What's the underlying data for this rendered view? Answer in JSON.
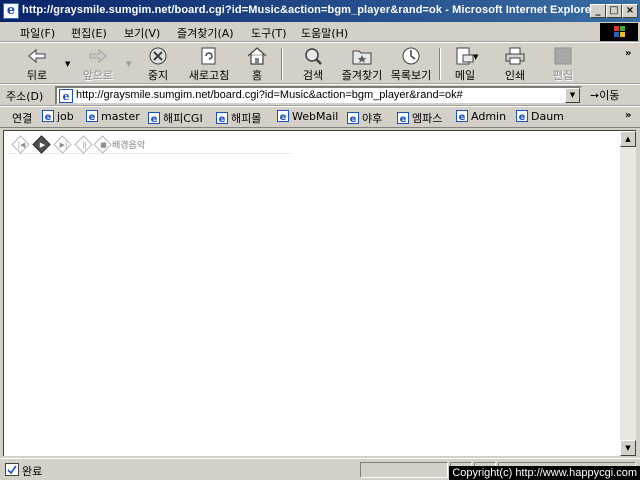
{
  "window": {
    "title": "http://graysmile.sumgim.net/board.cgi?id=Music&action=bgm_player&rand=ok - Microsoft Internet Explorer",
    "icon": "ie-icon",
    "minimize": "_",
    "maximize": "□",
    "close": "×"
  },
  "menu": {
    "items": [
      "파일(F)",
      "편집(E)",
      "보기(V)",
      "즐겨찾기(A)",
      "도구(T)",
      "도움말(H)"
    ]
  },
  "toolbar": {
    "back": "뒤로",
    "forward": "앞으로",
    "stop": "중지",
    "refresh": "새로고침",
    "home": "홈",
    "search": "검색",
    "favorites": "즐겨찾기",
    "history": "목록보기",
    "mail": "메일",
    "print": "인쇄",
    "edit": "편집"
  },
  "address": {
    "label": "주소(D)",
    "url": "http://graysmile.sumgim.net/board.cgi?id=Music&action=bgm_player&rand=ok#",
    "go": "이동"
  },
  "links": {
    "label": "연결",
    "items": [
      "job",
      "master",
      "해피CGI",
      "해피몰",
      "WebMail",
      "야후",
      "엠파스",
      "Admin",
      "Daum"
    ]
  },
  "player": {
    "controls": [
      "prev",
      "play",
      "next",
      "pause",
      "stop"
    ],
    "title": "배경음악"
  },
  "status": {
    "text": "완료"
  },
  "overlay": {
    "copyright": "Copyright(c) http://www.happycgi.com"
  },
  "colors": {
    "titlebar_start": "#0a246a",
    "titlebar_end": "#3a6ea5",
    "chrome": "#d4d0c8",
    "ie_blue": "#1a4fbf"
  }
}
